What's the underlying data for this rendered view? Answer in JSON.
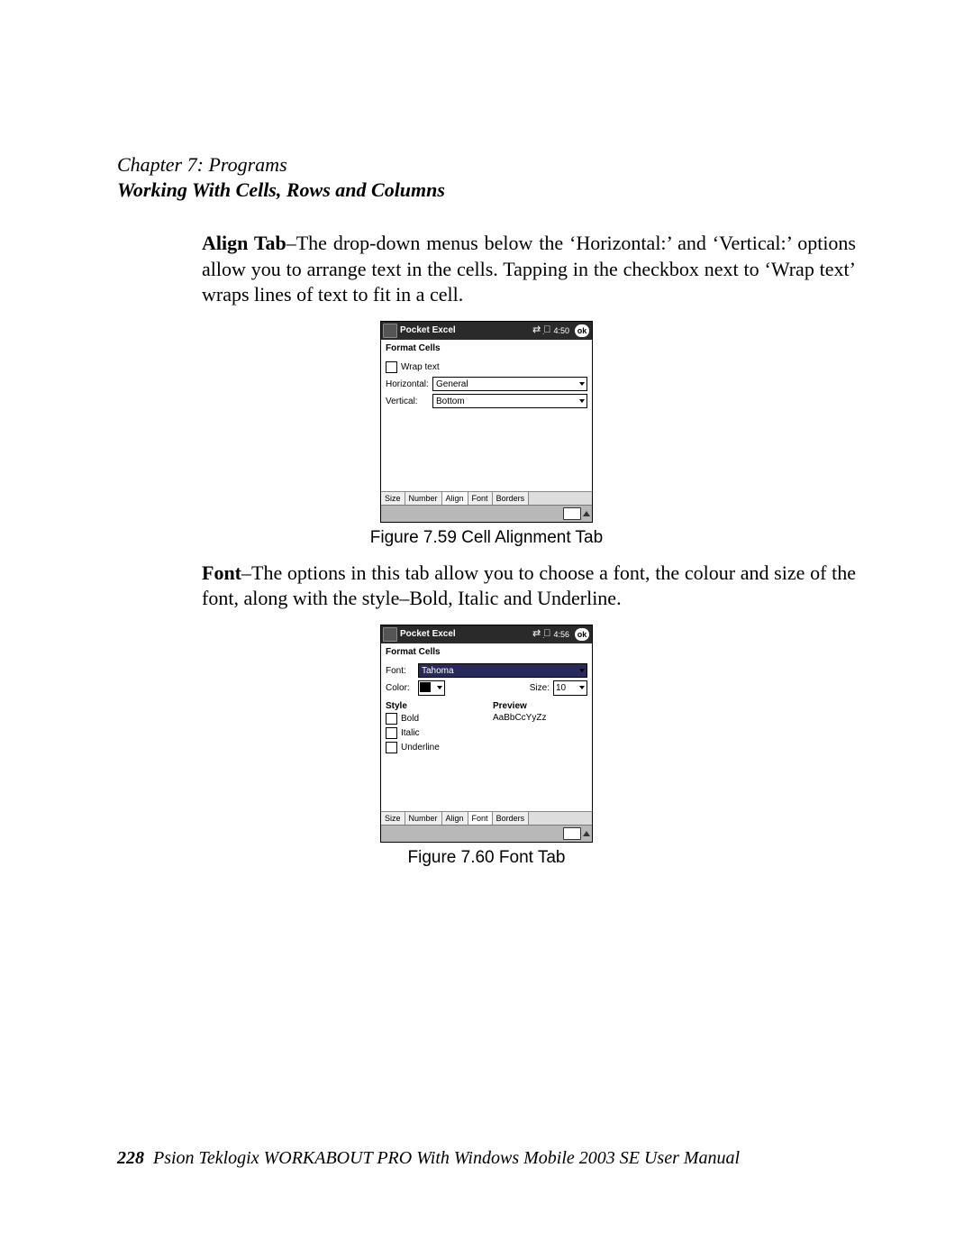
{
  "header": {
    "chapter": "Chapter 7: Programs",
    "section": "Working With Cells, Rows and Columns"
  },
  "para_align": {
    "lead": "Align Tab",
    "text": "–The drop-down menus below the ‘Horizontal:’ and ‘Vertical:’ options allow you to arrange text in the cells. Tapping in the checkbox next to ‘Wrap text’ wraps lines of text to fit in a cell."
  },
  "para_font": {
    "lead": "Font",
    "text": "–The options in this tab allow you to choose a font, the colour and size of the font, along with the style–Bold, Italic and Underline."
  },
  "fig1": {
    "caption": "Figure 7.59 Cell Alignment Tab",
    "title": "Pocket Excel",
    "time": "4:50",
    "ok": "ok",
    "subtitle": "Format Cells",
    "wrap_label": "Wrap text",
    "horiz_label": "Horizontal:",
    "horiz_value": "General",
    "vert_label": "Vertical:",
    "vert_value": "Bottom",
    "tabs": [
      "Size",
      "Number",
      "Align",
      "Font",
      "Borders"
    ]
  },
  "fig2": {
    "caption": "Figure 7.60 Font Tab",
    "title": "Pocket Excel",
    "time": "4:56",
    "ok": "ok",
    "subtitle": "Format Cells",
    "font_label": "Font:",
    "font_value": "Tahoma",
    "color_label": "Color:",
    "size_label": "Size:",
    "size_value": "10",
    "style_label": "Style",
    "preview_label": "Preview",
    "style_bold": "Bold",
    "style_italic": "Italic",
    "style_underline": "Underline",
    "preview_text": "AaBbCcYyZz",
    "tabs": [
      "Size",
      "Number",
      "Align",
      "Font",
      "Borders"
    ]
  },
  "footer": {
    "page": "228",
    "text": "Psion Teklogix WORKABOUT PRO With Windows Mobile 2003 SE User Manual"
  }
}
